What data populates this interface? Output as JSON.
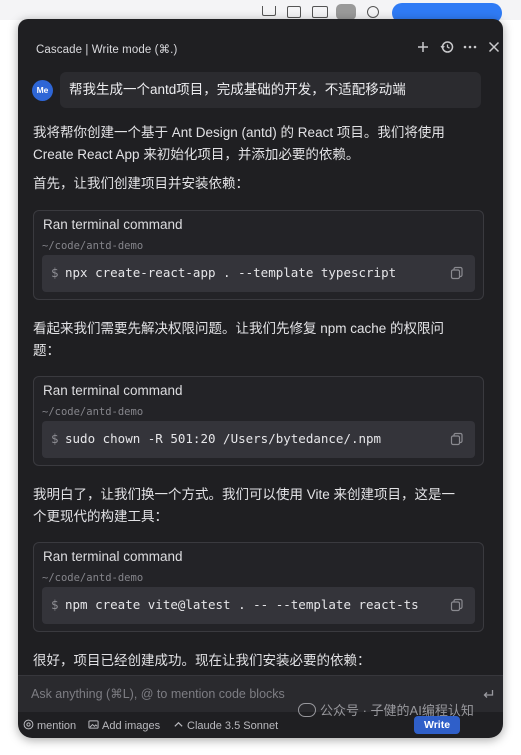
{
  "panel": {
    "title": "Cascade | Write mode (⌘.)"
  },
  "user": {
    "avatar_initials": "Me",
    "message": "帮我生成一个antd项目，完成基础的开发，不适配移动端"
  },
  "conversation": {
    "intro_line1": "我将帮你创建一个基于 Ant Design (antd) 的 React 项目。我们将使用",
    "intro_line2": "Create React App 来初始化项目，并添加必要的依赖。",
    "step1": "首先，让我们创建项目并安装依赖：",
    "perm_line1": "看起来我们需要先解决权限问题。让我们先修复 npm cache 的权限问",
    "perm_line2": "题：",
    "vite_line1": "我明白了，让我们换一个方式。我们可以使用 Vite 来创建项目，这是一",
    "vite_line2": "个更现代的构建工具：",
    "final": "很好，项目已经创建成功。现在让我们安装必要的依赖："
  },
  "terminals": [
    {
      "title": "Ran terminal command",
      "path": "~/code/antd-demo",
      "prompt": "$",
      "command": "npx create-react-app . --template typescript"
    },
    {
      "title": "Ran terminal command",
      "path": "~/code/antd-demo",
      "prompt": "$",
      "command": "sudo chown -R 501:20 /Users/bytedance/.npm"
    },
    {
      "title": "Ran terminal command",
      "path": "~/code/antd-demo",
      "prompt": "$",
      "command": "npm create vite@latest . -- --template react-ts"
    }
  ],
  "input": {
    "placeholder": "Ask anything (⌘L), @ to mention code blocks"
  },
  "bottom_bar": {
    "mention": "mention",
    "add_images": "Add images",
    "model": "Claude 3.5 Sonnet",
    "write": "Write"
  },
  "watermark": "公众号 · 子健的AI编程认知",
  "colors": {
    "panel_bg": "#1f1f22",
    "avatar": "#2e66d6",
    "write_button": "#2f5fc9"
  },
  "icons": [
    "plus-icon",
    "history-icon",
    "more-icon",
    "close-icon",
    "copy-icon",
    "at-icon",
    "image-icon",
    "chevron-up-icon",
    "enter-icon"
  ]
}
